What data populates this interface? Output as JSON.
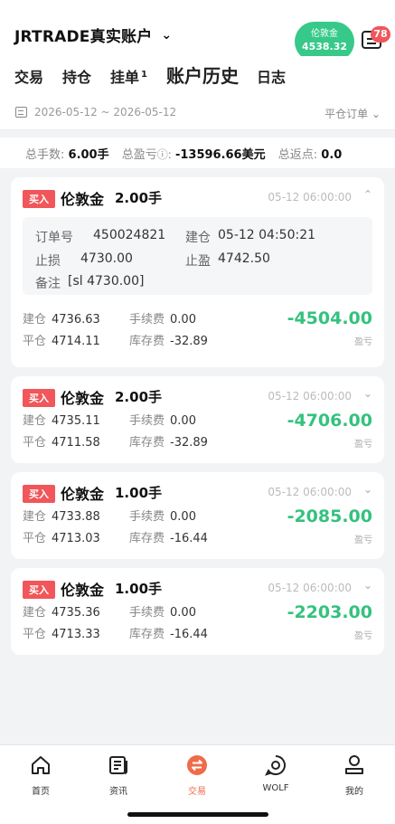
{
  "header": {
    "account_title": "JRTRADE真实账户",
    "quote_symbol": "伦敦金",
    "quote_price": "4538.32",
    "message_badge": "78"
  },
  "tabs": [
    {
      "label": "交易"
    },
    {
      "label": "持仓"
    },
    {
      "label": "挂单",
      "count": "1"
    },
    {
      "label": "账户历史"
    },
    {
      "label": "日志"
    }
  ],
  "filter": {
    "date_range": "2026-05-12 ~ 2026-05-12",
    "order_type": "平仓订单"
  },
  "summary": {
    "lots_label": "总手数:",
    "lots_value": "6.00手",
    "pnl_label": "总盈亏",
    "pnl_value": "-13596.66美元",
    "rebate_label": "总返点:",
    "rebate_value": "0.0"
  },
  "orders": [
    {
      "side": "买入",
      "symbol": "伦敦金",
      "lots": "2.00手",
      "time": "05-12 06:00:00",
      "order_no_label": "订单号",
      "order_no": "450024821",
      "open_time_label": "建仓",
      "open_time": "05-12 04:50:21",
      "sl_label": "止损",
      "sl": "4730.00",
      "tp_label": "止盈",
      "tp": "4742.50",
      "note_label": "备注",
      "note": "[sl 4730.00]",
      "open_label": "建仓",
      "open_price": "4736.63",
      "close_label": "平仓",
      "close_price": "4714.11",
      "fee_label": "手续费",
      "fee": "0.00",
      "swap_label": "库存费",
      "swap": "-32.89",
      "pnl": "-4504.00",
      "pnl_label": "盈亏"
    },
    {
      "side": "买入",
      "symbol": "伦敦金",
      "lots": "2.00手",
      "time": "05-12 06:00:00",
      "open_label": "建仓",
      "open_price": "4735.11",
      "close_label": "平仓",
      "close_price": "4711.58",
      "fee_label": "手续费",
      "fee": "0.00",
      "swap_label": "库存费",
      "swap": "-32.89",
      "pnl": "-4706.00",
      "pnl_label": "盈亏"
    },
    {
      "side": "买入",
      "symbol": "伦敦金",
      "lots": "1.00手",
      "time": "05-12 06:00:00",
      "open_label": "建仓",
      "open_price": "4733.88",
      "close_label": "平仓",
      "close_price": "4713.03",
      "fee_label": "手续费",
      "fee": "0.00",
      "swap_label": "库存费",
      "swap": "-16.44",
      "pnl": "-2085.00",
      "pnl_label": "盈亏"
    },
    {
      "side": "买入",
      "symbol": "伦敦金",
      "lots": "1.00手",
      "time": "05-12 06:00:00",
      "open_label": "建仓",
      "open_price": "4735.36",
      "close_label": "平仓",
      "close_price": "4713.33",
      "fee_label": "手续费",
      "fee": "0.00",
      "swap_label": "库存费",
      "swap": "-16.44",
      "pnl": "-2203.00",
      "pnl_label": "盈亏"
    }
  ],
  "nav": [
    {
      "label": "首页",
      "icon": "home-icon"
    },
    {
      "label": "资讯",
      "icon": "news-icon"
    },
    {
      "label": "交易",
      "icon": "trade-icon"
    },
    {
      "label": "WOLF",
      "icon": "wolf-icon"
    },
    {
      "label": "我的",
      "icon": "profile-icon"
    }
  ],
  "colors": {
    "accent": "#37c98a",
    "buy_tag": "#f0565a",
    "profit_text": "#34c27e",
    "active_nav": "#f06b4a"
  }
}
